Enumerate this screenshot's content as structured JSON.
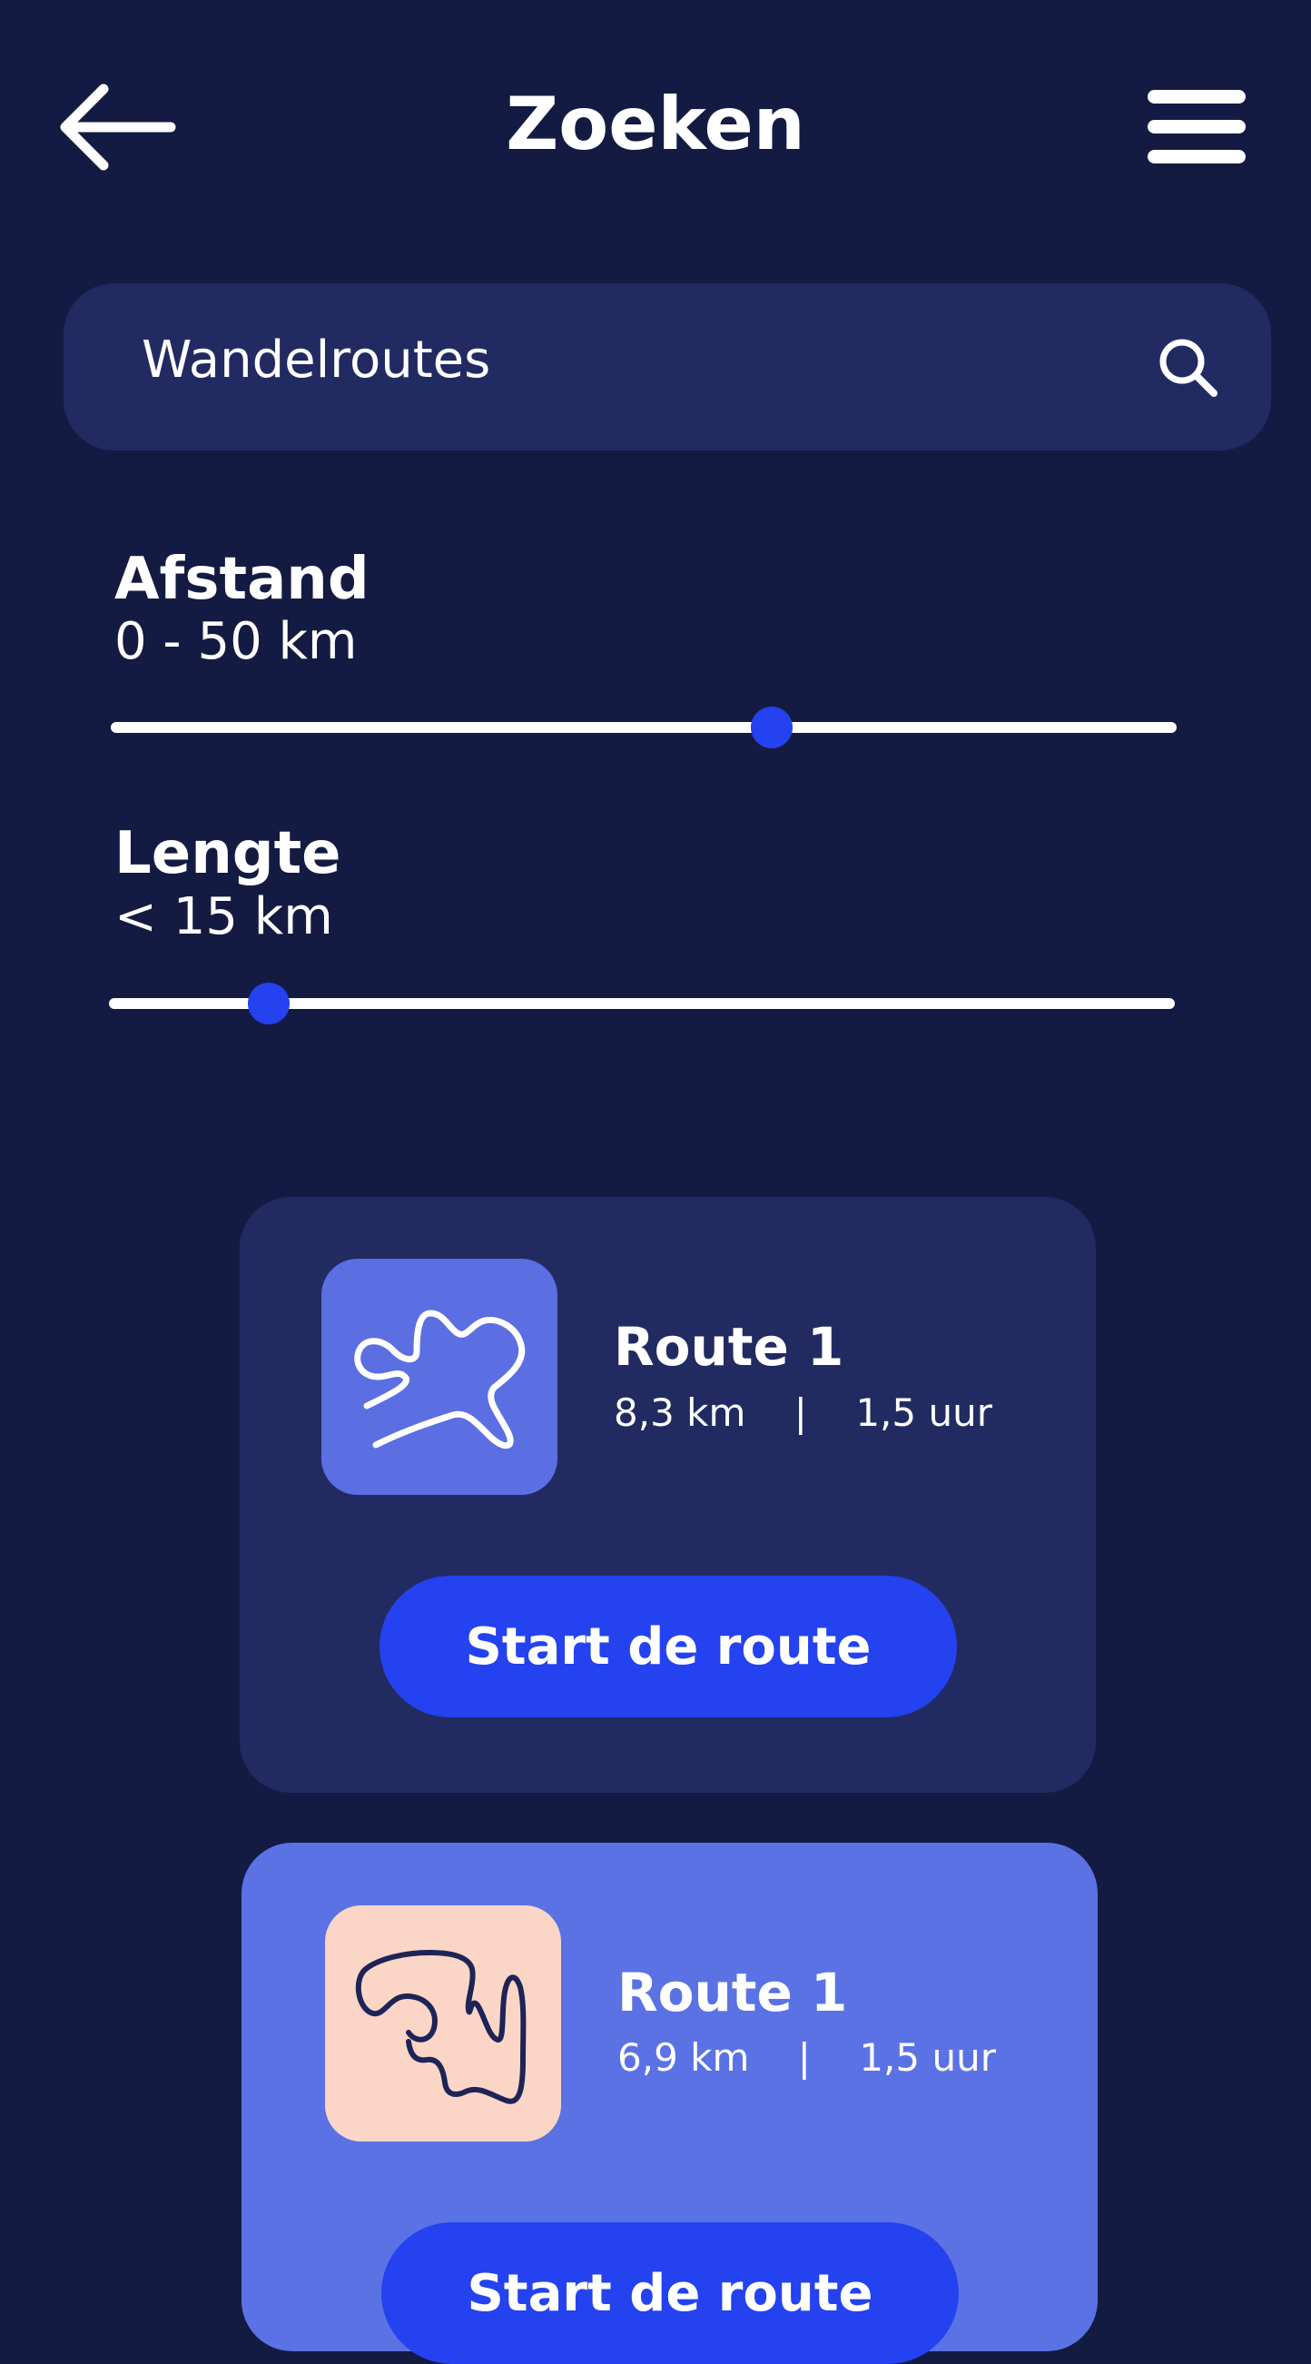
{
  "header": {
    "title": "Zoeken",
    "back_icon": "arrow-left-icon",
    "menu_icon": "hamburger-menu-icon"
  },
  "search": {
    "value": "Wandelroutes",
    "icon": "search-icon"
  },
  "filters": {
    "afstand": {
      "title": "Afstand",
      "value": "0 - 50 km",
      "slider_fraction": 0.62
    },
    "lengte": {
      "title": "Lengte",
      "value": "< 15 km",
      "slider_fraction": 0.15
    }
  },
  "routes": [
    {
      "title": "Route 1",
      "meta": "8,3 km    |    1,5 uur",
      "button_label": "Start de route",
      "card_color": "#212b62",
      "thumb_color": "#5b6fe3",
      "line_color": "#ffffff"
    },
    {
      "title": "Route 1",
      "meta": "6,9 km    |    1,5 uur",
      "button_label": "Start de route",
      "card_color": "#5b72e5",
      "thumb_color": "#fbd6c7",
      "line_color": "#1e2456"
    }
  ],
  "colors": {
    "background": "#141b42",
    "accent": "#2442ef",
    "surface": "#212b62"
  }
}
